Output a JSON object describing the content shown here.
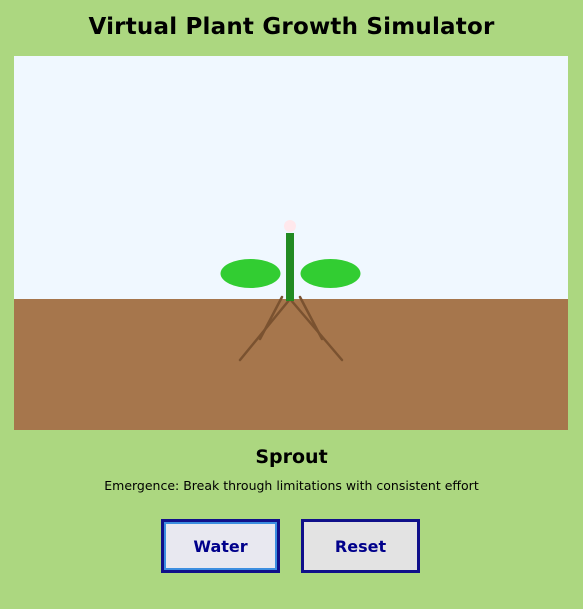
{
  "app": {
    "title": "Virtual Plant Growth Simulator"
  },
  "scene": {
    "sky_color": "#f0f8ff",
    "soil_color": "#a6764c",
    "stem_color": "#228b22",
    "leaf_color": "#32cd32",
    "bud_color": "#ffe8ec",
    "root_color": "#7a5230"
  },
  "status": {
    "stage_name": "Sprout",
    "stage_message": "Emergence: Break through limitations with consistent effort"
  },
  "controls": {
    "water_label": "Water",
    "reset_label": "Reset",
    "border_color": "#10108a",
    "text_color": "#00008b"
  }
}
